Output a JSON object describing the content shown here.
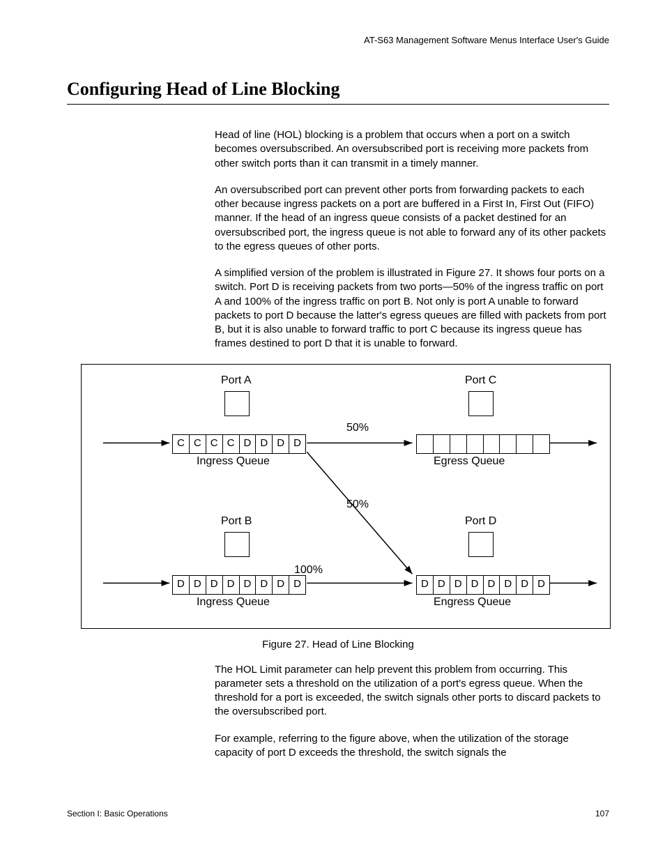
{
  "header": {
    "running_title": "AT-S63 Management Software Menus Interface User's Guide"
  },
  "section": {
    "title": "Configuring Head of Line Blocking"
  },
  "paragraphs": {
    "p1": "Head of line (HOL) blocking is a problem that occurs when a port on a switch becomes oversubscribed. An oversubscribed port is receiving more packets from other switch ports than it can transmit in a timely manner.",
    "p2": "An oversubscribed port can prevent other ports from forwarding packets to each other because ingress packets on a port are buffered in a First In, First Out (FIFO) manner. If the head of an ingress queue consists of a packet destined for an oversubscribed port, the ingress queue is not able to forward any of its other packets to the egress queues of other ports.",
    "p3": "A simplified version of the problem is illustrated in Figure 27. It shows four ports on a switch. Port D is receiving packets from two ports—50% of the ingress traffic on port A and 100% of the ingress traffic on port B. Not only is port A unable to forward packets to port D because the latter's egress queues are filled with packets from port B, but it is also unable to forward traffic to port C because its ingress queue has frames destined to port D that it is unable to forward.",
    "p4": "The HOL Limit parameter can help prevent this problem from occurring. This parameter sets a threshold on the utilization of a port's egress queue. When the threshold for a port is exceeded, the switch signals other ports to discard packets to the oversubscribed port.",
    "p5": "For example, referring to the figure above, when the utilization of the storage capacity of port D exceeds the threshold, the switch signals the"
  },
  "figure": {
    "caption": "Figure 27. Head of Line Blocking",
    "labels": {
      "portA": "Port A",
      "portB": "Port B",
      "portC": "Port C",
      "portD": "Port D",
      "ingressA": "Ingress Queue",
      "ingressB": "Ingress Queue",
      "egressC": "Egress Queue",
      "egressD": "Engress Queue",
      "pct50a": "50%",
      "pct50b": "50%",
      "pct100": "100%"
    },
    "queues": {
      "portA_ingress": [
        "C",
        "C",
        "C",
        "C",
        "D",
        "D",
        "D",
        "D"
      ],
      "portB_ingress": [
        "D",
        "D",
        "D",
        "D",
        "D",
        "D",
        "D",
        "D"
      ],
      "portC_egress": [
        "",
        "",
        "",
        "",
        "",
        "",
        "",
        ""
      ],
      "portD_egress": [
        "D",
        "D",
        "D",
        "D",
        "D",
        "D",
        "D",
        "D"
      ]
    }
  },
  "footer": {
    "left": "Section I: Basic Operations",
    "right": "107"
  },
  "chart_data": {
    "type": "diagram",
    "title": "Head of Line Blocking",
    "nodes": [
      {
        "id": "A",
        "label": "Port A",
        "queue_type": "Ingress Queue",
        "queue": [
          "C",
          "C",
          "C",
          "C",
          "D",
          "D",
          "D",
          "D"
        ]
      },
      {
        "id": "B",
        "label": "Port B",
        "queue_type": "Ingress Queue",
        "queue": [
          "D",
          "D",
          "D",
          "D",
          "D",
          "D",
          "D",
          "D"
        ]
      },
      {
        "id": "C",
        "label": "Port C",
        "queue_type": "Egress Queue",
        "queue": [
          "",
          "",
          "",
          "",
          "",
          "",
          "",
          ""
        ]
      },
      {
        "id": "D",
        "label": "Port D",
        "queue_type": "Engress Queue",
        "queue": [
          "D",
          "D",
          "D",
          "D",
          "D",
          "D",
          "D",
          "D"
        ]
      }
    ],
    "edges": [
      {
        "from": "A",
        "to": "C",
        "percent": 50
      },
      {
        "from": "A",
        "to": "D",
        "percent": 50
      },
      {
        "from": "B",
        "to": "D",
        "percent": 100
      }
    ]
  }
}
